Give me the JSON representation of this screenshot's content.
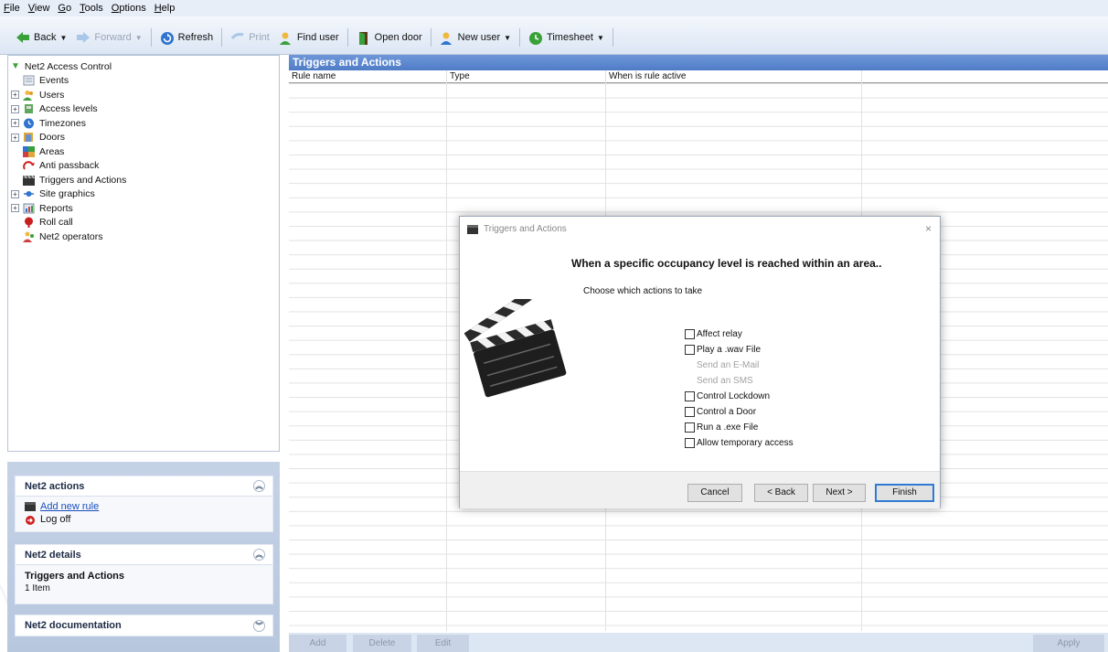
{
  "menu": [
    "File",
    "View",
    "Go",
    "Tools",
    "Options",
    "Help"
  ],
  "toolbar": {
    "back": "Back",
    "forward": "Forward",
    "refresh": "Refresh",
    "print": "Print",
    "find_user": "Find user",
    "open_door": "Open door",
    "new_user": "New user",
    "timesheet": "Timesheet"
  },
  "tree": {
    "root": "Net2 Access Control",
    "items": [
      {
        "label": "Events",
        "expandable": false,
        "icon": "events-icon"
      },
      {
        "label": "Users",
        "expandable": true,
        "icon": "users-icon"
      },
      {
        "label": "Access levels",
        "expandable": true,
        "icon": "access-levels-icon"
      },
      {
        "label": "Timezones",
        "expandable": true,
        "icon": "timezones-icon"
      },
      {
        "label": "Doors",
        "expandable": true,
        "icon": "doors-icon"
      },
      {
        "label": "Areas",
        "expandable": false,
        "icon": "areas-icon"
      },
      {
        "label": "Anti passback",
        "expandable": false,
        "icon": "anti-passback-icon"
      },
      {
        "label": "Triggers and Actions",
        "expandable": false,
        "icon": "clapperboard-icon"
      },
      {
        "label": "Site graphics",
        "expandable": true,
        "icon": "site-graphics-icon"
      },
      {
        "label": "Reports",
        "expandable": true,
        "icon": "reports-icon"
      },
      {
        "label": "Roll call",
        "expandable": false,
        "icon": "roll-call-icon"
      },
      {
        "label": "Net2 operators",
        "expandable": false,
        "icon": "operators-icon"
      }
    ]
  },
  "panels": {
    "actions": {
      "title": "Net2 actions",
      "add_rule": "Add new rule",
      "log_off": "Log off"
    },
    "details": {
      "title": "Net2 details",
      "heading": "Triggers and Actions",
      "count": "1 Item"
    },
    "documentation": {
      "title": "Net2 documentation"
    }
  },
  "main": {
    "title": "Triggers and Actions",
    "columns": [
      "Rule name",
      "Type",
      "When is rule active"
    ]
  },
  "bottom_buttons": {
    "add": "Add",
    "delete": "Delete",
    "edit": "Edit",
    "apply": "Apply"
  },
  "dialog": {
    "title": "Triggers and Actions",
    "close": "×",
    "heading": "When a specific occupancy level is reached within an area..",
    "subheading": "Choose which actions to take",
    "options": [
      {
        "label": "Affect relay",
        "enabled": true
      },
      {
        "label": "Play a .wav File",
        "enabled": true
      },
      {
        "label": "Send an E-Mail",
        "enabled": false
      },
      {
        "label": "Send an SMS",
        "enabled": false
      },
      {
        "label": "Control Lockdown",
        "enabled": true
      },
      {
        "label": "Control a Door",
        "enabled": true
      },
      {
        "label": "Run a .exe File",
        "enabled": true
      },
      {
        "label": "Allow temporary access",
        "enabled": true
      }
    ],
    "buttons": {
      "cancel": "Cancel",
      "back": "< Back",
      "next": "Next >",
      "finish": "Finish"
    }
  },
  "colors": {
    "accent": "#4f7cc6",
    "panel_bg": "#b7c7de",
    "link": "#1a4fbf",
    "default_button_border": "#2f7bd4"
  }
}
